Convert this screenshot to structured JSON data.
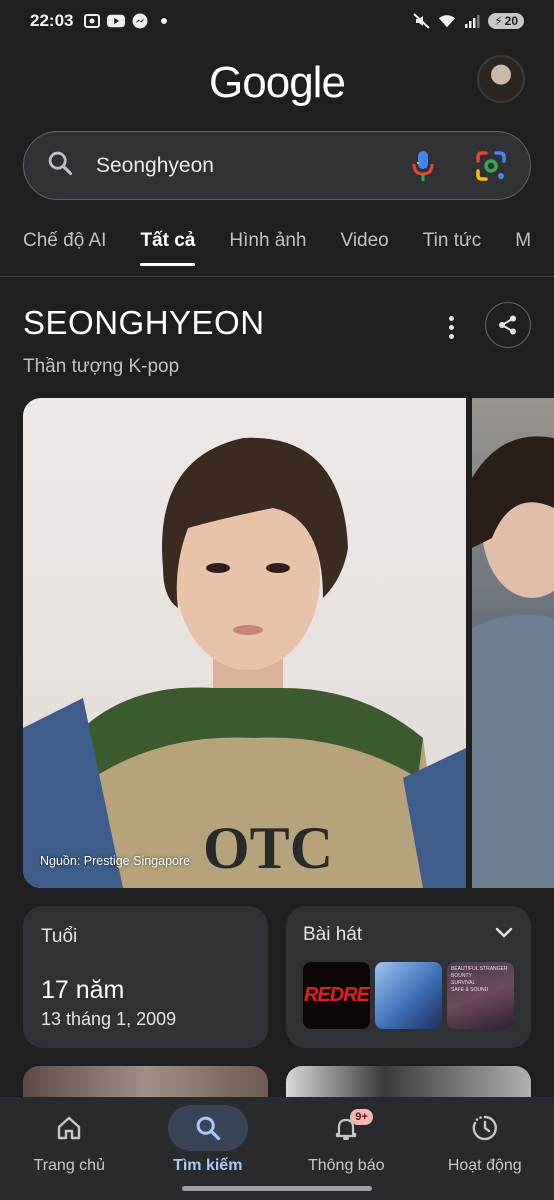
{
  "status_bar": {
    "time": "22:03",
    "battery": "20"
  },
  "header": {
    "logo": "Google"
  },
  "search": {
    "query": "Seonghyeon"
  },
  "tabs": [
    {
      "label": "Chế độ AI"
    },
    {
      "label": "Tất cả"
    },
    {
      "label": "Hình ảnh"
    },
    {
      "label": "Video"
    },
    {
      "label": "Tin tức"
    },
    {
      "label": "M"
    }
  ],
  "knowledge_panel": {
    "title": "SEONGHYEON",
    "subtitle": "Thần tượng K-pop",
    "photo_credit": "Nguồn: Prestige Singapore",
    "age_card": {
      "label": "Tuổi",
      "value": "17 năm",
      "dob": "13 tháng 1, 2009"
    },
    "songs_card": {
      "label": "Bài hát",
      "thumb1_text": "REDRE",
      "thumb3_lines": [
        "BEAUTIFUL STRANGER",
        "BOUNTY",
        "SURVIVAL",
        "SAFE & SOUND"
      ]
    }
  },
  "bottom_nav": [
    {
      "label": "Trang chủ"
    },
    {
      "label": "Tìm kiếm"
    },
    {
      "label": "Thông báo",
      "badge": "9+"
    },
    {
      "label": "Hoạt động"
    }
  ]
}
